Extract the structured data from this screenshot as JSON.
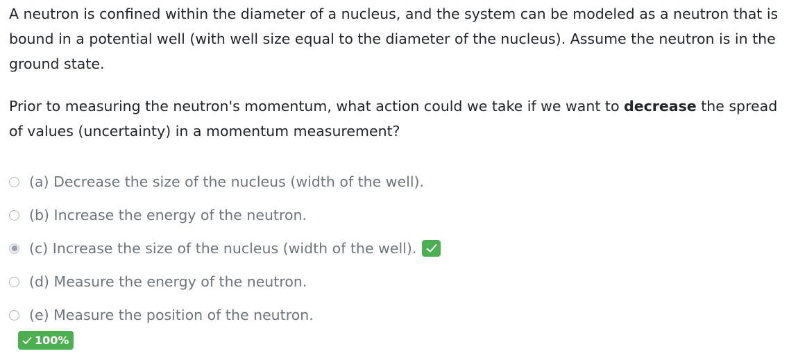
{
  "question": {
    "intro": "A neutron is confined within the diameter of a nucleus, and the system can be modeled as a neutron that is bound in a potential well (with well size equal to the diameter of the nucleus). Assume the neutron is in the ground state.",
    "prompt_before": "Prior to measuring the neutron's momentum, what action could we take if we want to ",
    "prompt_emphasis": "decrease",
    "prompt_after": " the spread of values (uncertainty) in a momentum measurement?"
  },
  "options": [
    {
      "label": "(a) Decrease the size of the nucleus (width of the well).",
      "selected": false,
      "correct": false
    },
    {
      "label": "(b) Increase the energy of the neutron.",
      "selected": false,
      "correct": false
    },
    {
      "label": "(c) Increase the size of the nucleus (width of the well).",
      "selected": true,
      "correct": true
    },
    {
      "label": "(d) Measure the energy of the neutron.",
      "selected": false,
      "correct": false
    },
    {
      "label": "(e) Measure the position of the neutron.",
      "selected": false,
      "correct": false
    }
  ],
  "score": {
    "label": "100%",
    "icon": "check-icon",
    "color": "#4caf50"
  }
}
